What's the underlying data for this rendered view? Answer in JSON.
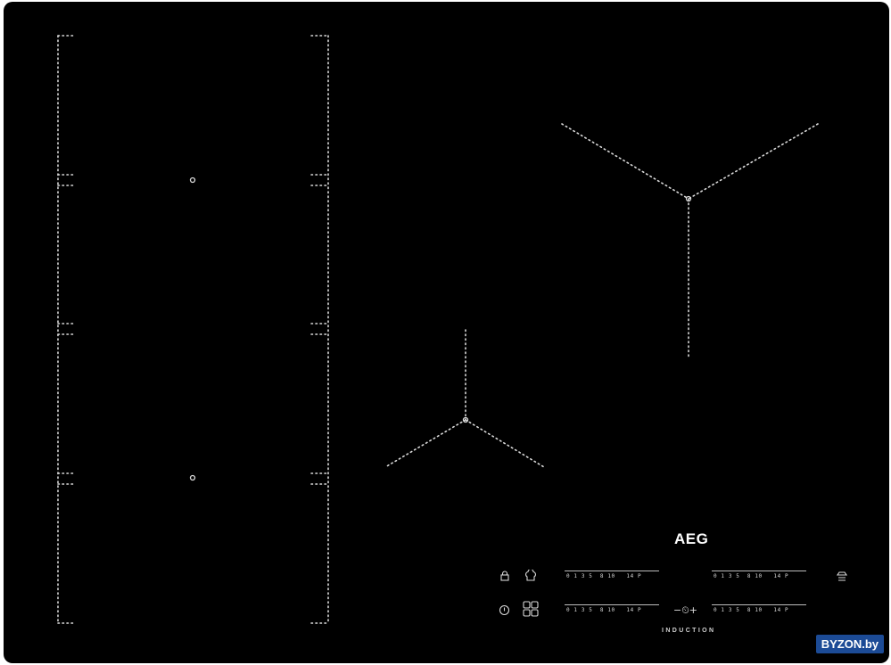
{
  "brand": "AEG",
  "technology_label": "INDUCTION",
  "watermark": "BYZON.by",
  "slider_scale": "0 1 3 5  8 10   14 P",
  "controls": {
    "lock_icon": "lock-icon",
    "chef_hat_icon": "chef-hat-icon",
    "power_icon": "power-icon",
    "hob2hood_icon": "hob2hood-icon",
    "zones_icon": "zone-selector-icon",
    "timer_label": "−⏲+"
  },
  "colors": {
    "glass": "#000000",
    "markings": "#e6e6e6",
    "watermark_bg": "#1c4b96"
  }
}
